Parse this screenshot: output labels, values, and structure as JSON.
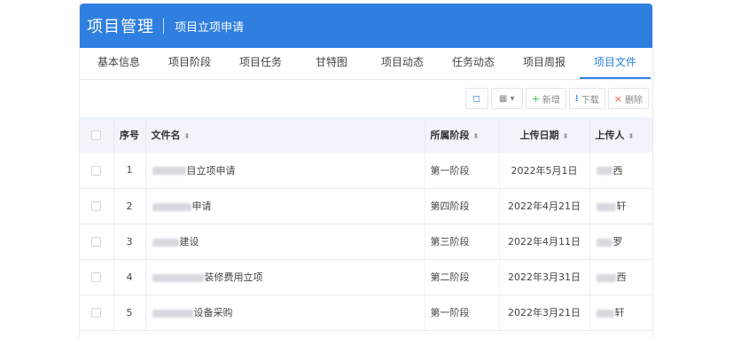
{
  "header": {
    "title": "项目管理",
    "subtitle": "项目立项申请"
  },
  "tabs": [
    {
      "label": "基本信息",
      "active": false
    },
    {
      "label": "项目阶段",
      "active": false
    },
    {
      "label": "项目任务",
      "active": false
    },
    {
      "label": "甘特图",
      "active": false
    },
    {
      "label": "项目动态",
      "active": false
    },
    {
      "label": "任务动态",
      "active": false
    },
    {
      "label": "项目周报",
      "active": false
    },
    {
      "label": "项目文件",
      "active": true
    }
  ],
  "toolbar": {
    "refresh_icon": "refresh-icon",
    "columns_icon": "grid-icon",
    "columns_glyph": "▦ ▾",
    "add_label": "新增",
    "download_label": "下载",
    "delete_label": "删除"
  },
  "table": {
    "columns": {
      "index": "序号",
      "name": "文件名",
      "stage": "所属阶段",
      "date": "上传日期",
      "uploader": "上传人"
    },
    "rows": [
      {
        "index": "1",
        "name_visible": "目立项申请",
        "stage": "第一阶段",
        "date": "2022年5月1日",
        "uploader_visible": "西"
      },
      {
        "index": "2",
        "name_visible": "申请",
        "stage": "第四阶段",
        "date": "2022年4月21日",
        "uploader_visible": "轩"
      },
      {
        "index": "3",
        "name_visible": "建设",
        "stage": "第三阶段",
        "date": "2022年4月11日",
        "uploader_visible": "罗"
      },
      {
        "index": "4",
        "name_visible": "装修费用立项",
        "stage": "第二阶段",
        "date": "2022年3月31日",
        "uploader_visible": "西"
      },
      {
        "index": "5",
        "name_visible": "设备采购",
        "stage": "第一阶段",
        "date": "2022年3月21日",
        "uploader_visible": "轩"
      }
    ]
  }
}
